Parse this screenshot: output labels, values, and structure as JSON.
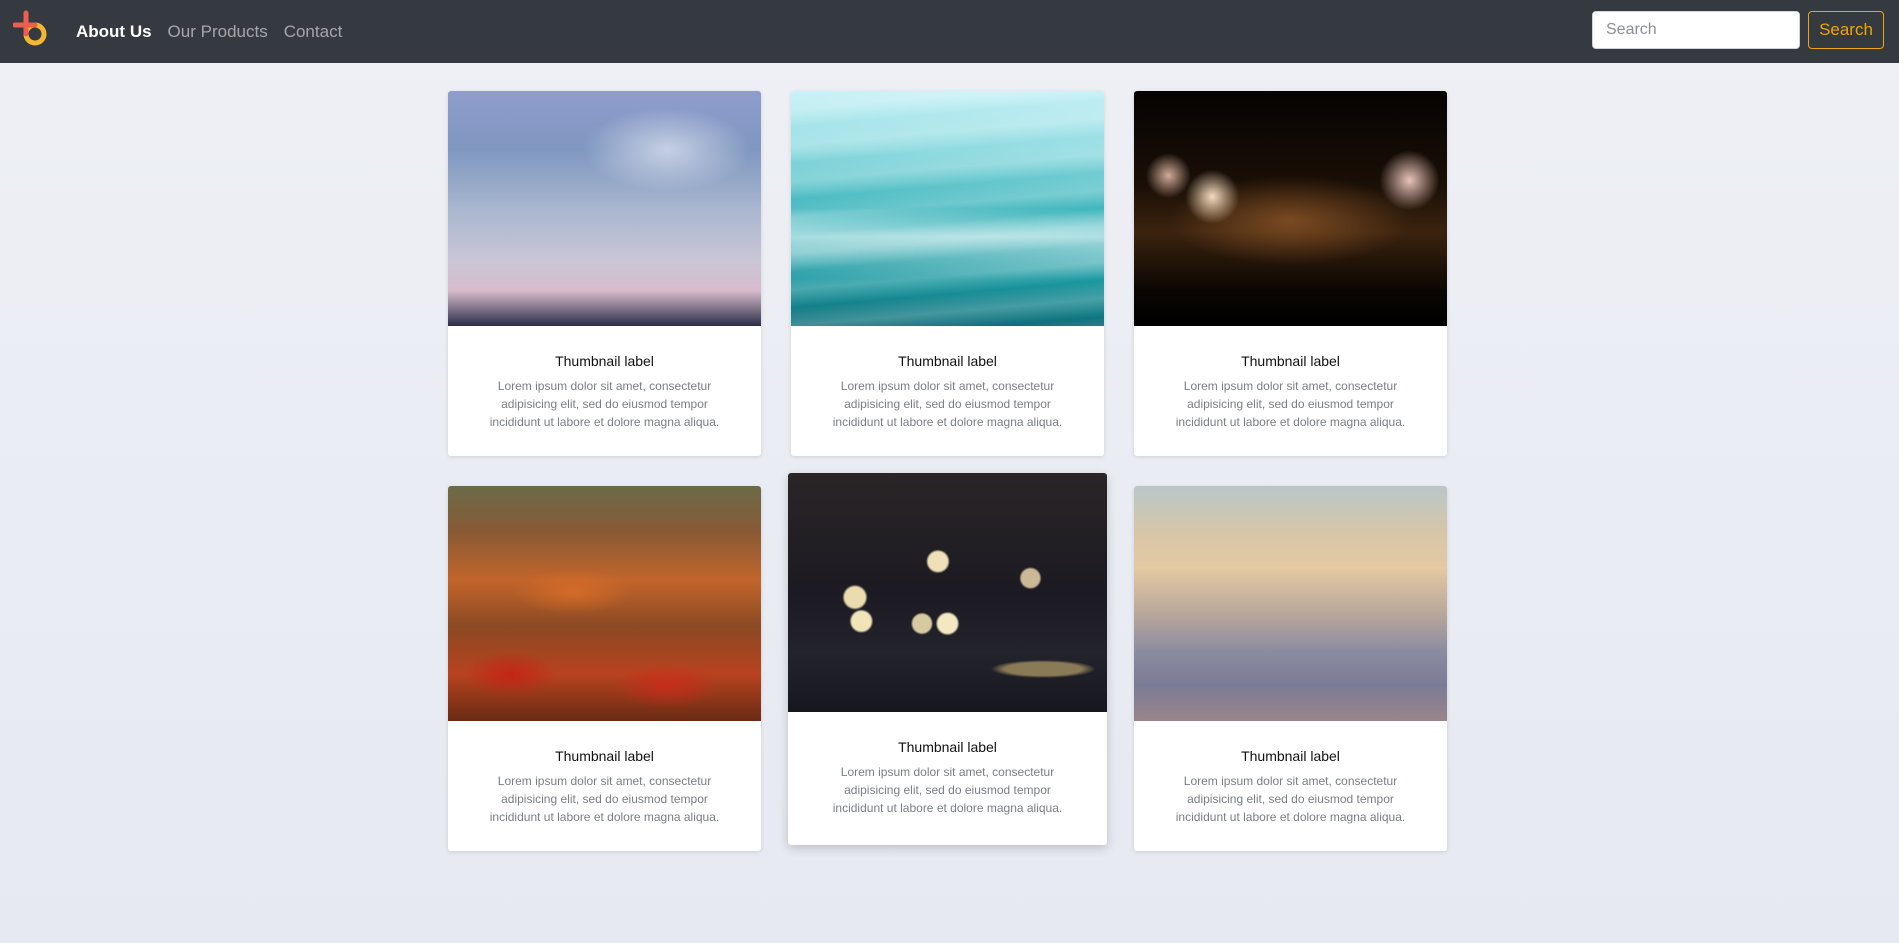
{
  "navbar": {
    "links": [
      {
        "label": "About Us",
        "active": true
      },
      {
        "label": "Our Products",
        "active": false
      },
      {
        "label": "Contact",
        "active": false
      }
    ],
    "search": {
      "placeholder": "Search",
      "button_label": "Search"
    },
    "accent_color": "#f0a30a",
    "background_color": "#343a40"
  },
  "cards": [
    {
      "title": "Thumbnail label",
      "text": "Lorem ipsum dolor sit amet, consectetur adipisicing elit, sed do eiusmod tempor incididunt ut labore et dolore magna aliqua."
    },
    {
      "title": "Thumbnail label",
      "text": "Lorem ipsum dolor sit amet, consectetur adipisicing elit, sed do eiusmod tempor incididunt ut labore et dolore magna aliqua."
    },
    {
      "title": "Thumbnail label",
      "text": "Lorem ipsum dolor sit amet, consectetur adipisicing elit, sed do eiusmod tempor incididunt ut labore et dolore magna aliqua."
    },
    {
      "title": "Thumbnail label",
      "text": "Lorem ipsum dolor sit amet, consectetur adipisicing elit, sed do eiusmod tempor incididunt ut labore et dolore magna aliqua."
    },
    {
      "title": "Thumbnail label",
      "text": "Lorem ipsum dolor sit amet, consectetur adipisicing elit, sed do eiusmod tempor incididunt ut labore et dolore magna aliqua."
    },
    {
      "title": "Thumbnail label",
      "text": "Lorem ipsum dolor sit amet, consectetur adipisicing elit, sed do eiusmod tempor incididunt ut labore et dolore magna aliqua."
    }
  ]
}
